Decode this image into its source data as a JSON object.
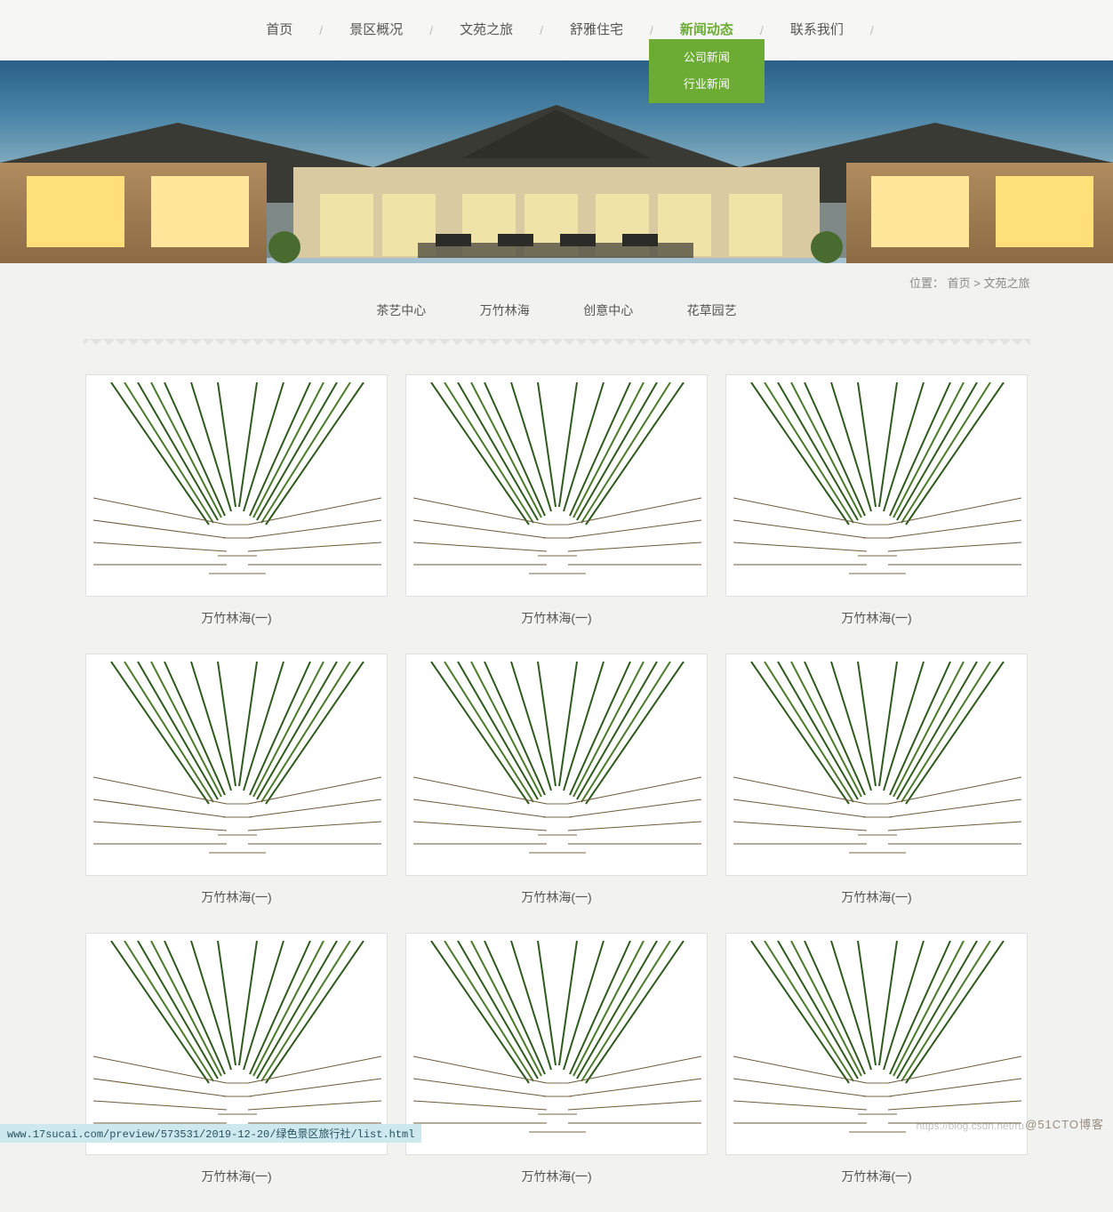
{
  "nav": {
    "items": [
      {
        "label": "首页",
        "active": false
      },
      {
        "label": "景区概况",
        "active": false
      },
      {
        "label": "文苑之旅",
        "active": false
      },
      {
        "label": "舒雅住宅",
        "active": false
      },
      {
        "label": "新闻动态",
        "active": true,
        "submenu": [
          "公司新闻",
          "行业新闻"
        ]
      },
      {
        "label": "联系我们",
        "active": false
      }
    ],
    "separator": "/"
  },
  "breadcrumb": {
    "label": "位置：",
    "home": "首页",
    "sep": ">",
    "current": "文苑之旅"
  },
  "categories": [
    "茶艺中心",
    "万竹林海",
    "创意中心",
    "花草园艺"
  ],
  "cards": [
    {
      "title": "万竹林海(一)"
    },
    {
      "title": "万竹林海(一)"
    },
    {
      "title": "万竹林海(一)"
    },
    {
      "title": "万竹林海(一)"
    },
    {
      "title": "万竹林海(一)"
    },
    {
      "title": "万竹林海(一)"
    },
    {
      "title": "万竹林海(一)"
    },
    {
      "title": "万竹林海(一)"
    },
    {
      "title": "万竹林海(一)"
    }
  ],
  "statusbar": "www.17sucai.com/preview/573531/2019-12-20/绿色景区旅行社/list.html",
  "watermark_right": "@51CTO博客",
  "watermark_center": "https://blog.csdn.net/ru"
}
